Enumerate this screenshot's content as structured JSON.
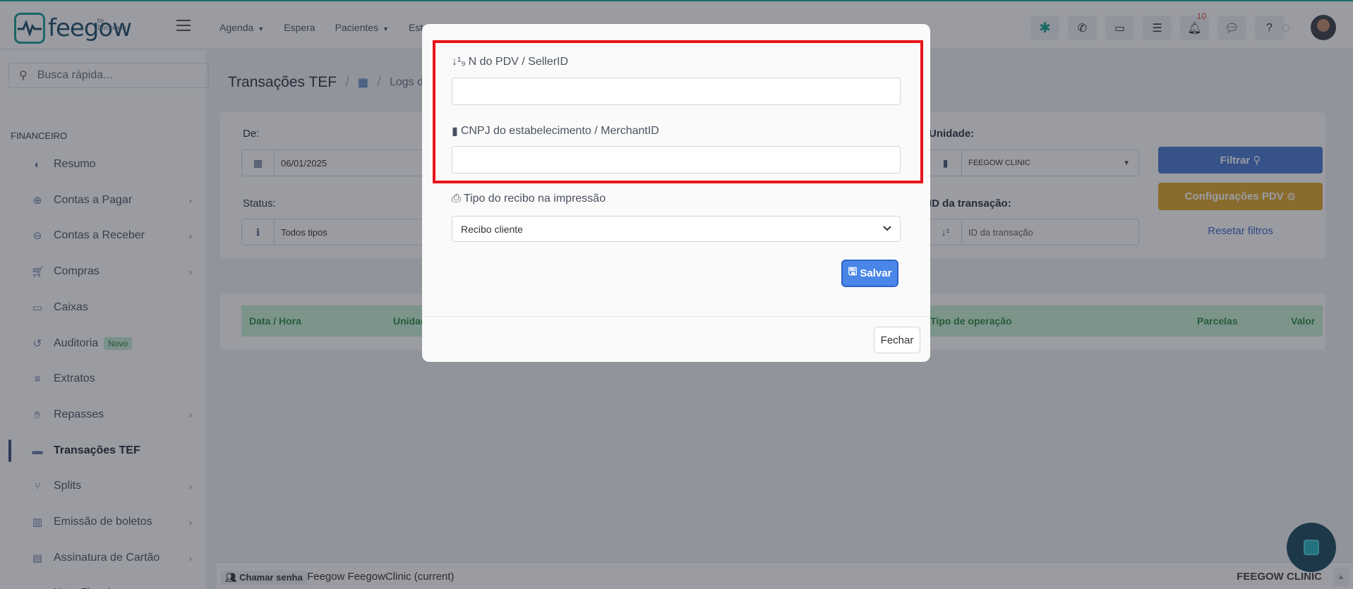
{
  "brand": {
    "name": "feegow",
    "by": "by Doctoralia"
  },
  "topnav": [
    {
      "label": "Agenda",
      "dropdown": true
    },
    {
      "label": "Espera",
      "dropdown": false
    },
    {
      "label": "Pacientes",
      "dropdown": true
    },
    {
      "label": "Est",
      "dropdown": false
    }
  ],
  "notifications_count": "10",
  "search": {
    "placeholder": "Busca rápida..."
  },
  "sidebar": {
    "section": "FINANCEIRO",
    "items": [
      {
        "label": "Resumo",
        "icon": "palette-icon",
        "chevron": false
      },
      {
        "label": "Contas a Pagar",
        "icon": "arrow-up-circle-icon",
        "chevron": true
      },
      {
        "label": "Contas a Receber",
        "icon": "arrow-down-circle-icon",
        "chevron": true
      },
      {
        "label": "Compras",
        "icon": "cart-icon",
        "chevron": true
      },
      {
        "label": "Caixas",
        "icon": "inbox-icon",
        "chevron": false
      },
      {
        "label": "Auditoria",
        "icon": "history-icon",
        "chevron": false,
        "badge": "Novo"
      },
      {
        "label": "Extratos",
        "icon": "list-icon",
        "chevron": false
      },
      {
        "label": "Repasses",
        "icon": "hand-icon",
        "chevron": true
      },
      {
        "label": "Transações TEF",
        "icon": "card-icon",
        "chevron": false,
        "active": true
      },
      {
        "label": "Splits",
        "icon": "branch-icon",
        "chevron": true
      },
      {
        "label": "Emissão de boletos",
        "icon": "barcode-icon",
        "chevron": true
      },
      {
        "label": "Assinatura de Cartão",
        "icon": "id-card-icon",
        "chevron": true
      },
      {
        "label": "Nota Fiscal",
        "icon": "receipt-icon",
        "chevron": true
      }
    ]
  },
  "main": {
    "title": "Transações TEF",
    "crumb": "Logs de",
    "filters": {
      "de_label": "De:",
      "de_value": "06/01/2025",
      "status_label": "Status:",
      "status_value": "Todos tipos",
      "unidade_label": "Unidade:",
      "unidade_value": "FEEGOW CLINIC",
      "id_label": "ID da transação:",
      "id_placeholder": "ID da transação",
      "filtrar": "Filtrar",
      "config": "Configurações PDV",
      "reset": "Resetar filtros"
    },
    "table_headers": [
      "Data / Hora",
      "Unidad",
      "Tipo de operação",
      "Parcelas",
      "Valor"
    ]
  },
  "footer": {
    "chamar": "Chamar senha",
    "current": "Feegow FeegowClinic (current)",
    "unit": "FEEGOW CLINIC"
  },
  "modal": {
    "pdv_label": "N do PDV / SellerID",
    "pdv_value": "",
    "cnpj_label": "CNPJ do estabelecimento / MerchantID",
    "cnpj_value": "",
    "recibo_label": "Tipo do recibo na impressão",
    "recibo_value": "Recibo cliente",
    "salvar": "Salvar",
    "fechar": "Fechar"
  },
  "colors": {
    "accent": "#4a78cf",
    "brand": "#1b9e93",
    "warning": "#e0a82b",
    "highlight": "#e8141a"
  }
}
